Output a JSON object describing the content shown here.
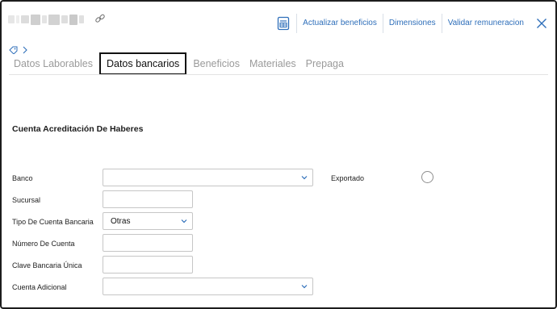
{
  "toolbar": {
    "update_benefits": "Actualizar beneficios",
    "dimensions": "Dimensiones",
    "validate_pay": "Validar remuneracion"
  },
  "tabs": [
    {
      "label": "Datos Laborables"
    },
    {
      "label": "Datos bancarios"
    },
    {
      "label": "Beneficios"
    },
    {
      "label": "Materiales"
    },
    {
      "label": "Prepaga"
    }
  ],
  "active_tab": "Datos bancarios",
  "section": {
    "title": "Cuenta Acreditación De Haberes"
  },
  "form": {
    "bank_label": "Banco",
    "bank_value": "",
    "branch_label": "Sucursal",
    "branch_value": "",
    "account_type_label": "Tipo De Cuenta Bancaria",
    "account_type_value": "Otras",
    "account_number_label": "Número De Cuenta",
    "account_number_value": "",
    "cbu_label": "Clave Bancaria Única",
    "cbu_value": "",
    "extra_account_label": "Cuenta Adicional",
    "extra_account_value": "",
    "exported_label": "Exportado"
  },
  "colors": {
    "accent": "#2f6fba",
    "inactive_tab": "#9a9a9a",
    "border": "#c6c6c6"
  },
  "icons": [
    "link-icon",
    "spreadsheet-icon",
    "close-icon",
    "tag-icon",
    "chevron-right-icon",
    "chevron-down-icon"
  ]
}
